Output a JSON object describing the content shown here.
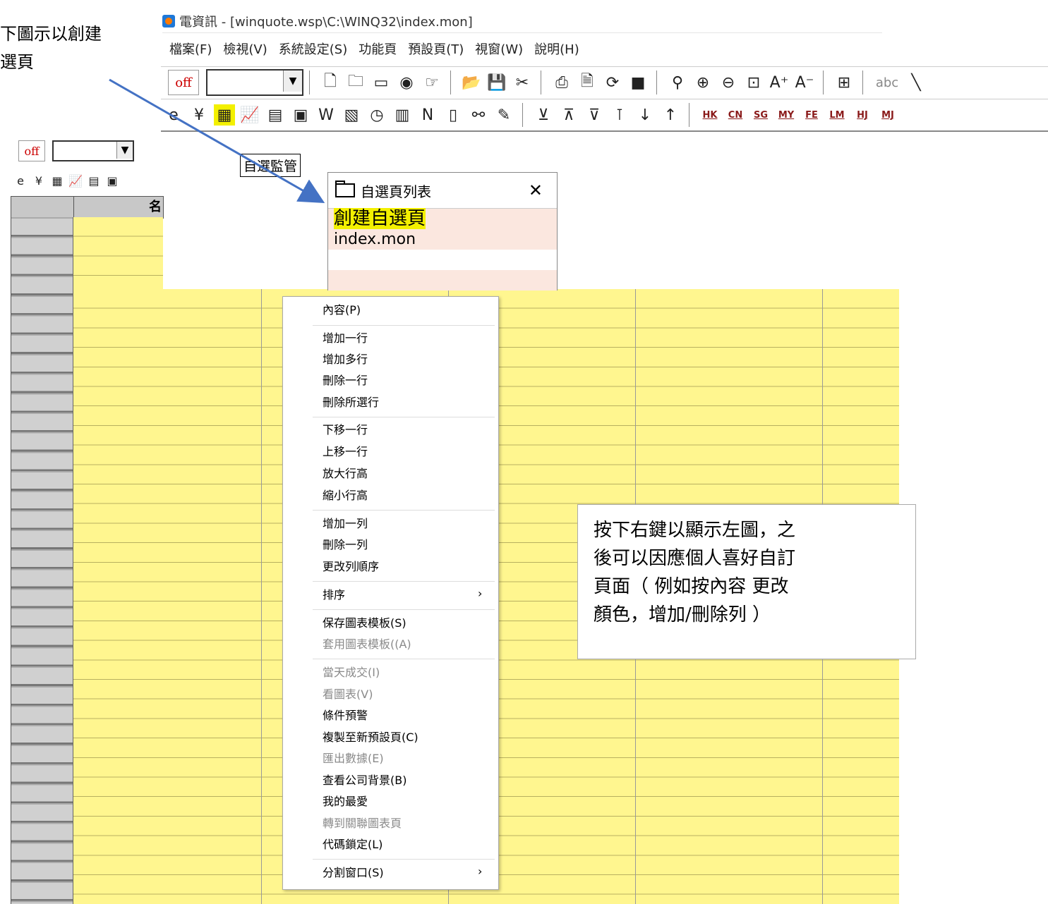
{
  "caption_top_left": "下圖示以創建\n選頁",
  "window_title": "電資訊 - [winquote.wsp\\C:\\WINQ32\\index.mon]",
  "menu": [
    "檔案(F)",
    "檢視(V)",
    "系統設定(S)",
    "功能頁",
    "預設頁(T)",
    "視窗(W)",
    "說明(H)"
  ],
  "toolbar": {
    "off_label": "off",
    "abc_label": "abc",
    "market_buttons": [
      "HK",
      "CN",
      "SG",
      "MY",
      "FE",
      "LM",
      "HJ",
      "MJ"
    ]
  },
  "tooltip": "自選監管",
  "grid": {
    "header_col1": "名"
  },
  "popup": {
    "title": "自選頁列表",
    "close_symbol": "✕",
    "items": [
      "創建自選頁",
      "index.mon"
    ]
  },
  "context_menu": [
    {
      "label": "內容(P)",
      "disabled": false
    },
    {
      "label": "增加一行",
      "disabled": false
    },
    {
      "label": "增加多行",
      "disabled": false
    },
    {
      "label": "刪除一行",
      "disabled": false
    },
    {
      "label": "刪除所選行",
      "disabled": false
    },
    {
      "label": "下移一行",
      "disabled": false
    },
    {
      "label": "上移一行",
      "disabled": false
    },
    {
      "label": "放大行高",
      "disabled": false
    },
    {
      "label": "縮小行高",
      "disabled": false
    },
    {
      "label": "增加一列",
      "disabled": false
    },
    {
      "label": "刪除一列",
      "disabled": false
    },
    {
      "label": "更改列順序",
      "disabled": false
    },
    {
      "label": "排序",
      "disabled": false
    },
    {
      "label": "保存圖表模板(S)",
      "disabled": false
    },
    {
      "label": "套用圖表模板((A)",
      "disabled": true
    },
    {
      "label": "當天成交(I)",
      "disabled": true
    },
    {
      "label": "看圖表(V)",
      "disabled": true
    },
    {
      "label": "條件預警",
      "disabled": false
    },
    {
      "label": "複製至新預設頁(C)",
      "disabled": false
    },
    {
      "label": "匯出數據(E)",
      "disabled": true
    },
    {
      "label": "查看公司背景(B)",
      "disabled": false
    },
    {
      "label": "我的最愛",
      "disabled": false
    },
    {
      "label": "轉到關聯圖表頁",
      "disabled": true
    },
    {
      "label": "代碼鎖定(L)",
      "disabled": false
    },
    {
      "label": "分割窗口(S)",
      "disabled": false
    }
  ],
  "submenu_arrow": "›",
  "caption_right": "按下右鍵以顯示左圖，之\n後可以因應個人喜好自訂\n頁面（ 例如按內容 更改\n顏色，增加/刪除列 ）",
  "colors": {
    "grid_yellow": "#fff68f",
    "highlight": "#f3f000",
    "arrow": "#4472c4",
    "popup_row": "#fbe7df"
  }
}
